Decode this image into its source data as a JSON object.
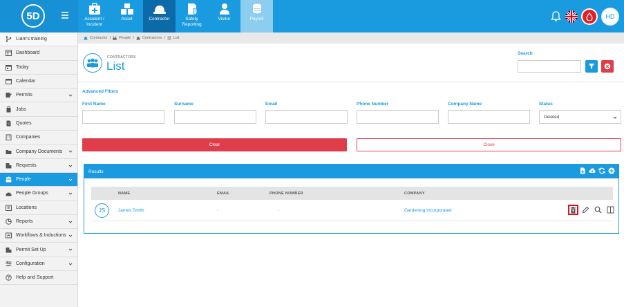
{
  "brand": {
    "logo_text": "5D"
  },
  "modules": [
    {
      "label": "Accident / Incident",
      "icon": "first-aid-icon",
      "active": false
    },
    {
      "label": "Asset",
      "icon": "boxes-icon",
      "active": false
    },
    {
      "label": "Contractor",
      "icon": "hard-hat-icon",
      "active": true
    },
    {
      "label": "Safety Reporting",
      "icon": "shield-document-icon",
      "active": false
    },
    {
      "label": "Visitor",
      "icon": "person-icon",
      "active": false
    },
    {
      "label": "Payroll",
      "icon": "coins-icon",
      "active": false
    }
  ],
  "user": {
    "initials": "HD"
  },
  "sidebar": {
    "items": [
      {
        "label": "Liam's training",
        "icon": "branch-icon",
        "has_chevron": false
      },
      {
        "label": "Dashboard",
        "icon": "dashboard-icon",
        "has_chevron": false
      },
      {
        "label": "Today",
        "icon": "calendar-day-icon",
        "has_chevron": false
      },
      {
        "label": "Calendar",
        "icon": "calendar-icon",
        "has_chevron": false
      },
      {
        "label": "Permits",
        "icon": "permit-icon",
        "has_chevron": true
      },
      {
        "label": "Jobs",
        "icon": "briefcase-icon",
        "has_chevron": false
      },
      {
        "label": "Quotes",
        "icon": "document-icon",
        "has_chevron": false
      },
      {
        "label": "Companies",
        "icon": "building-icon",
        "has_chevron": false
      },
      {
        "label": "Company Documents",
        "icon": "folder-icon",
        "has_chevron": true
      },
      {
        "label": "Requests",
        "icon": "request-icon",
        "has_chevron": true
      },
      {
        "label": "People",
        "icon": "people-icon",
        "has_chevron": true
      },
      {
        "label": "People Groups",
        "icon": "group-icon",
        "has_chevron": true
      },
      {
        "label": "Locations",
        "icon": "location-icon",
        "has_chevron": false
      },
      {
        "label": "Reports",
        "icon": "chart-icon",
        "has_chevron": true
      },
      {
        "label": "Workflows & Inductions",
        "icon": "workflow-icon",
        "has_chevron": true
      },
      {
        "label": "Permit Set Up",
        "icon": "setup-icon",
        "has_chevron": true
      },
      {
        "label": "Configuration",
        "icon": "sliders-icon",
        "has_chevron": true
      },
      {
        "label": "Help and Support",
        "icon": "help-icon",
        "has_chevron": false
      }
    ],
    "active_index": 10
  },
  "breadcrumb": [
    "Contractor",
    "People",
    "Contractors",
    "List"
  ],
  "header": {
    "subtitle": "CONTRACTORS",
    "title": "List"
  },
  "search": {
    "label": "Search",
    "value": ""
  },
  "filters": {
    "title": "Advanced Filters",
    "fields": [
      {
        "label": "First Name",
        "value": ""
      },
      {
        "label": "Surname",
        "value": ""
      },
      {
        "label": "Email",
        "value": ""
      },
      {
        "label": "Phone Number",
        "value": ""
      },
      {
        "label": "Company Name",
        "value": ""
      }
    ],
    "status": {
      "label": "Status",
      "selected": "Deleted"
    },
    "clear_label": "Clear",
    "close_label": "Close"
  },
  "results": {
    "title": "Results",
    "columns": [
      "NAME",
      "EMAIL",
      "PHONE NUMBER",
      "COMPANY"
    ],
    "rows": [
      {
        "initials": "JS",
        "name": "James Smith",
        "email": "-",
        "phone": "-",
        "company": "Gardening Incorporated"
      }
    ]
  },
  "colors": {
    "primary": "#1a9be0",
    "danger": "#e03d4a",
    "highlight": "#d9141e"
  }
}
